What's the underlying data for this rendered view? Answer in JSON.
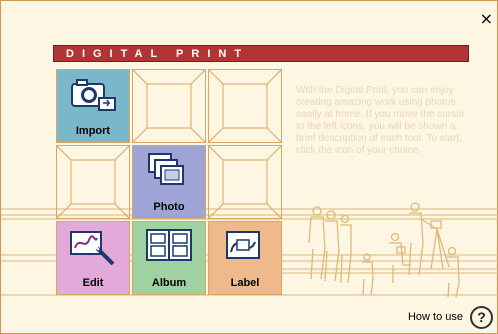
{
  "window": {
    "close_glyph": "×"
  },
  "banner": {
    "title": "DIGITAL PRINT"
  },
  "description": "With the Digital Print, you can enjoy creating amazing work using photos easily at home. If you move the cursor to the left icons, you will be shown a brief description of each tool. To start, click the icon of your choice.",
  "tools": {
    "import": {
      "label": "Import",
      "icon": "camera-import-icon",
      "color": "#79b7c9"
    },
    "photo": {
      "label": "Photo",
      "icon": "photo-stack-icon",
      "color": "#9fa4d6"
    },
    "edit": {
      "label": "Edit",
      "icon": "edit-pen-icon",
      "color": "#e3a9d8"
    },
    "album": {
      "label": "Album",
      "icon": "album-book-icon",
      "color": "#9fd2a0"
    },
    "label": {
      "label": "Label",
      "icon": "label-disc-icon",
      "color": "#f0b98c"
    }
  },
  "help": {
    "label": "How to use",
    "glyph": "?"
  },
  "colors": {
    "background": "#fdf6e2",
    "line": "#d9a560",
    "banner": "#b23535"
  }
}
